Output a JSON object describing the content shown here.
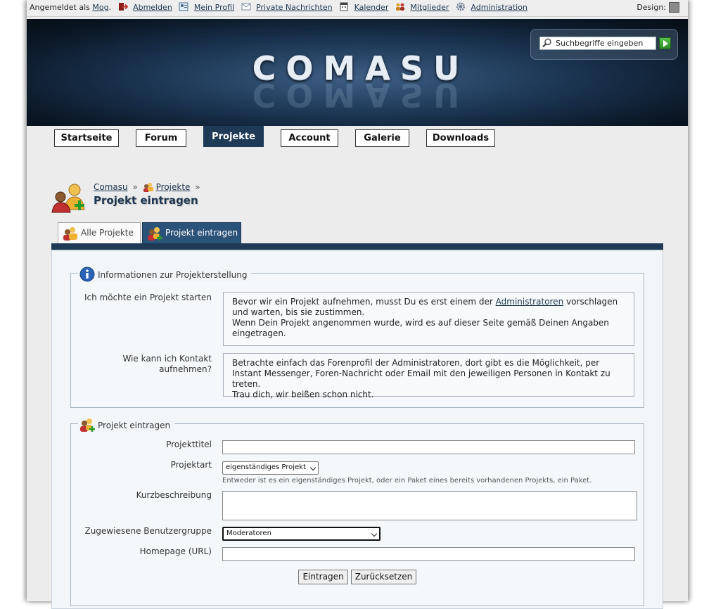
{
  "topbar": {
    "logged_in_prefix": "Angemeldet als",
    "username": "Mog",
    "items": [
      {
        "label": "Abmelden",
        "icon": "logout-icon"
      },
      {
        "label": "Mein Profil",
        "icon": "profile-icon"
      },
      {
        "label": "Private Nachrichten",
        "icon": "envelope-icon"
      },
      {
        "label": "Kalender",
        "icon": "calendar-icon"
      },
      {
        "label": "Mitglieder",
        "icon": "members-icon"
      },
      {
        "label": "Administration",
        "icon": "gear-icon"
      }
    ],
    "design_label": "Design:"
  },
  "header": {
    "logo_text": "COMASU",
    "search_placeholder": "Suchbegriffe eingeben"
  },
  "nav": {
    "tabs": [
      "Startseite",
      "Forum",
      "Projekte",
      "Account",
      "Galerie",
      "Downloads"
    ],
    "active": "Projekte"
  },
  "breadcrumb": {
    "home": "Comasu",
    "section": "Projekte",
    "separator": "»",
    "title": "Projekt eintragen"
  },
  "subtabs": {
    "all": "Alle Projekte",
    "add": "Projekt eintragen"
  },
  "info": {
    "legend": "Informationen zur Projekterstellung",
    "q1_label": "Ich möchte ein Projekt starten",
    "q1_text_a": "Bevor wir ein Projekt aufnehmen, musst Du es erst einem der",
    "q1_link": "Administratoren",
    "q1_text_b": "vorschlagen und warten, bis sie zustimmen.",
    "q1_text_c": "Wenn Dein Projekt angenommen wurde, wird es auf dieser Seite gemäß Deinen Angaben eingetragen.",
    "q2_label": "Wie kann ich Kontakt aufnehmen?",
    "q2_text_a": "Betrachte einfach das Forenprofil der Administratoren, dort gibt es die Möglichkeit, per Instant Messenger, Foren-Nachricht oder Email mit den jeweiligen Personen in Kontakt zu treten.",
    "q2_text_b": "Trau dich, wir beißen schon nicht."
  },
  "form": {
    "legend": "Projekt eintragen",
    "title_label": "Projekttitel",
    "title_value": "",
    "type_label": "Projektart",
    "type_value": "eigenständiges Projekt",
    "type_hint": "Entweder ist es ein eigenständiges Projekt, oder ein Paket eines bereits vorhandenen Projekts, ein Paket.",
    "desc_label": "Kurzbeschreibung",
    "desc_value": "",
    "group_label": "Zugewiesene Benutzergruppe",
    "group_value": "Moderatoren",
    "homepage_label": "Homepage (URL)",
    "homepage_value": "",
    "submit_label": "Eintragen",
    "reset_label": "Zurücksetzen"
  }
}
